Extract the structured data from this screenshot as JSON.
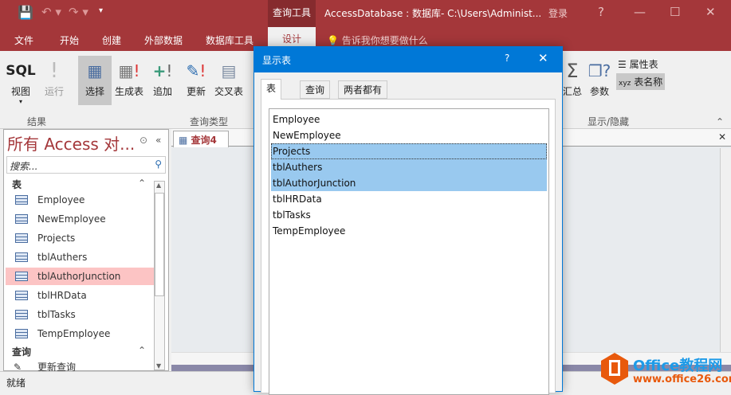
{
  "title_bar": {
    "context_tab": "查询工具",
    "title": "AccessDatabase : 数据库- C:\\Users\\Administ...",
    "signin": "登录",
    "help": "?",
    "minimize": "—",
    "maximize": "☐",
    "close": "✕"
  },
  "ribbon_tabs": [
    "文件",
    "开始",
    "创建",
    "外部数据",
    "数据库工具",
    "设计"
  ],
  "tell_me": "告诉我你想要做什么",
  "ribbon": {
    "results": {
      "label": "结果",
      "buttons": [
        "视图",
        "运行"
      ],
      "sql": "SQL"
    },
    "query_type": {
      "label": "查询类型",
      "buttons": [
        "选择",
        "生成表",
        "追加",
        "更新",
        "交叉表"
      ]
    },
    "show_hide": {
      "label": "显示/隐藏",
      "buttons": [
        "汇总",
        "参数",
        "属性表",
        "表名称"
      ]
    }
  },
  "nav": {
    "title": "所有 Access 对...",
    "search_placeholder": "搜索...",
    "sections": [
      {
        "label": "表",
        "items": [
          "Employee",
          "NewEmployee",
          "Projects",
          "tblAuthers",
          "tblAuthorJunction",
          "tblHRData",
          "tblTasks",
          "TempEmployee"
        ]
      },
      {
        "label": "查询",
        "items": [
          "更新查询"
        ]
      }
    ]
  },
  "document_tab": "查询4",
  "status": "就绪",
  "dialog": {
    "title": "显示表",
    "help": "?",
    "tabs": [
      "表",
      "查询",
      "两者都有"
    ],
    "items": [
      "Employee",
      "NewEmployee",
      "Projects",
      "tblAuthers",
      "tblAuthorJunction",
      "tblHRData",
      "tblTasks",
      "TempEmployee"
    ],
    "selected": [
      2,
      3,
      4
    ]
  },
  "watermark": {
    "brand": "Office教程网",
    "url": "www.office26.com"
  },
  "colors": {
    "accent": "#a4373a",
    "dialog": "#0078d7",
    "selection": "#99c9ef",
    "nav_highlight": "#fcc4c4"
  }
}
